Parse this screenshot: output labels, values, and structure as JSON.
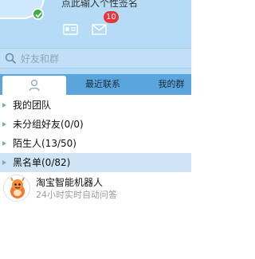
{
  "header": {
    "signature_placeholder": "点此输入个性签名",
    "mail_count": "10",
    "icons": {
      "status": "online-check-icon",
      "contacts": "contact-card-icon",
      "mail": "envelope-icon"
    }
  },
  "search": {
    "placeholder": "好友和群",
    "icon": "search-icon"
  },
  "tabs": [
    {
      "label": "",
      "icon": "person-icon"
    },
    {
      "label": "最近联系"
    },
    {
      "label": "我的群"
    }
  ],
  "groups": [
    {
      "label": "我的团队"
    },
    {
      "label": "未分组好友(0/0)"
    },
    {
      "label": "陌生人(13/50)"
    },
    {
      "label": "黑名单(0/82)"
    }
  ],
  "contact": {
    "name": "淘宝智能机器人",
    "status": "24小时实时自动问答"
  },
  "colors": {
    "header_bg": "#b5dbf6",
    "tab_bar": "#5aa6dc",
    "selected_row": "#cfe5f6",
    "badge": "#e8353b"
  }
}
